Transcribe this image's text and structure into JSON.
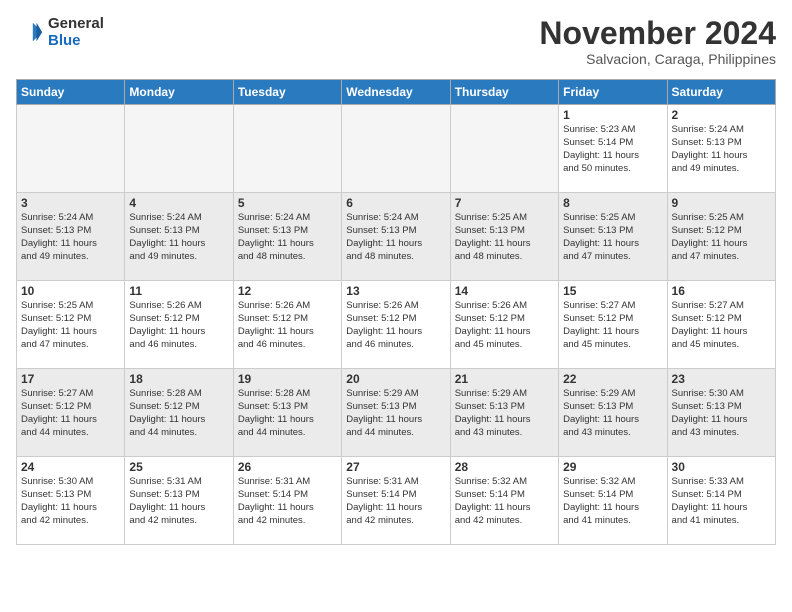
{
  "header": {
    "logo_line1": "General",
    "logo_line2": "Blue",
    "month_title": "November 2024",
    "subtitle": "Salvacion, Caraga, Philippines"
  },
  "weekdays": [
    "Sunday",
    "Monday",
    "Tuesday",
    "Wednesday",
    "Thursday",
    "Friday",
    "Saturday"
  ],
  "weeks": [
    [
      {
        "day": "",
        "info": ""
      },
      {
        "day": "",
        "info": ""
      },
      {
        "day": "",
        "info": ""
      },
      {
        "day": "",
        "info": ""
      },
      {
        "day": "",
        "info": ""
      },
      {
        "day": "1",
        "info": "Sunrise: 5:23 AM\nSunset: 5:14 PM\nDaylight: 11 hours\nand 50 minutes."
      },
      {
        "day": "2",
        "info": "Sunrise: 5:24 AM\nSunset: 5:13 PM\nDaylight: 11 hours\nand 49 minutes."
      }
    ],
    [
      {
        "day": "3",
        "info": "Sunrise: 5:24 AM\nSunset: 5:13 PM\nDaylight: 11 hours\nand 49 minutes."
      },
      {
        "day": "4",
        "info": "Sunrise: 5:24 AM\nSunset: 5:13 PM\nDaylight: 11 hours\nand 49 minutes."
      },
      {
        "day": "5",
        "info": "Sunrise: 5:24 AM\nSunset: 5:13 PM\nDaylight: 11 hours\nand 48 minutes."
      },
      {
        "day": "6",
        "info": "Sunrise: 5:24 AM\nSunset: 5:13 PM\nDaylight: 11 hours\nand 48 minutes."
      },
      {
        "day": "7",
        "info": "Sunrise: 5:25 AM\nSunset: 5:13 PM\nDaylight: 11 hours\nand 48 minutes."
      },
      {
        "day": "8",
        "info": "Sunrise: 5:25 AM\nSunset: 5:13 PM\nDaylight: 11 hours\nand 47 minutes."
      },
      {
        "day": "9",
        "info": "Sunrise: 5:25 AM\nSunset: 5:12 PM\nDaylight: 11 hours\nand 47 minutes."
      }
    ],
    [
      {
        "day": "10",
        "info": "Sunrise: 5:25 AM\nSunset: 5:12 PM\nDaylight: 11 hours\nand 47 minutes."
      },
      {
        "day": "11",
        "info": "Sunrise: 5:26 AM\nSunset: 5:12 PM\nDaylight: 11 hours\nand 46 minutes."
      },
      {
        "day": "12",
        "info": "Sunrise: 5:26 AM\nSunset: 5:12 PM\nDaylight: 11 hours\nand 46 minutes."
      },
      {
        "day": "13",
        "info": "Sunrise: 5:26 AM\nSunset: 5:12 PM\nDaylight: 11 hours\nand 46 minutes."
      },
      {
        "day": "14",
        "info": "Sunrise: 5:26 AM\nSunset: 5:12 PM\nDaylight: 11 hours\nand 45 minutes."
      },
      {
        "day": "15",
        "info": "Sunrise: 5:27 AM\nSunset: 5:12 PM\nDaylight: 11 hours\nand 45 minutes."
      },
      {
        "day": "16",
        "info": "Sunrise: 5:27 AM\nSunset: 5:12 PM\nDaylight: 11 hours\nand 45 minutes."
      }
    ],
    [
      {
        "day": "17",
        "info": "Sunrise: 5:27 AM\nSunset: 5:12 PM\nDaylight: 11 hours\nand 44 minutes."
      },
      {
        "day": "18",
        "info": "Sunrise: 5:28 AM\nSunset: 5:12 PM\nDaylight: 11 hours\nand 44 minutes."
      },
      {
        "day": "19",
        "info": "Sunrise: 5:28 AM\nSunset: 5:13 PM\nDaylight: 11 hours\nand 44 minutes."
      },
      {
        "day": "20",
        "info": "Sunrise: 5:29 AM\nSunset: 5:13 PM\nDaylight: 11 hours\nand 44 minutes."
      },
      {
        "day": "21",
        "info": "Sunrise: 5:29 AM\nSunset: 5:13 PM\nDaylight: 11 hours\nand 43 minutes."
      },
      {
        "day": "22",
        "info": "Sunrise: 5:29 AM\nSunset: 5:13 PM\nDaylight: 11 hours\nand 43 minutes."
      },
      {
        "day": "23",
        "info": "Sunrise: 5:30 AM\nSunset: 5:13 PM\nDaylight: 11 hours\nand 43 minutes."
      }
    ],
    [
      {
        "day": "24",
        "info": "Sunrise: 5:30 AM\nSunset: 5:13 PM\nDaylight: 11 hours\nand 42 minutes."
      },
      {
        "day": "25",
        "info": "Sunrise: 5:31 AM\nSunset: 5:13 PM\nDaylight: 11 hours\nand 42 minutes."
      },
      {
        "day": "26",
        "info": "Sunrise: 5:31 AM\nSunset: 5:14 PM\nDaylight: 11 hours\nand 42 minutes."
      },
      {
        "day": "27",
        "info": "Sunrise: 5:31 AM\nSunset: 5:14 PM\nDaylight: 11 hours\nand 42 minutes."
      },
      {
        "day": "28",
        "info": "Sunrise: 5:32 AM\nSunset: 5:14 PM\nDaylight: 11 hours\nand 42 minutes."
      },
      {
        "day": "29",
        "info": "Sunrise: 5:32 AM\nSunset: 5:14 PM\nDaylight: 11 hours\nand 41 minutes."
      },
      {
        "day": "30",
        "info": "Sunrise: 5:33 AM\nSunset: 5:14 PM\nDaylight: 11 hours\nand 41 minutes."
      }
    ]
  ]
}
